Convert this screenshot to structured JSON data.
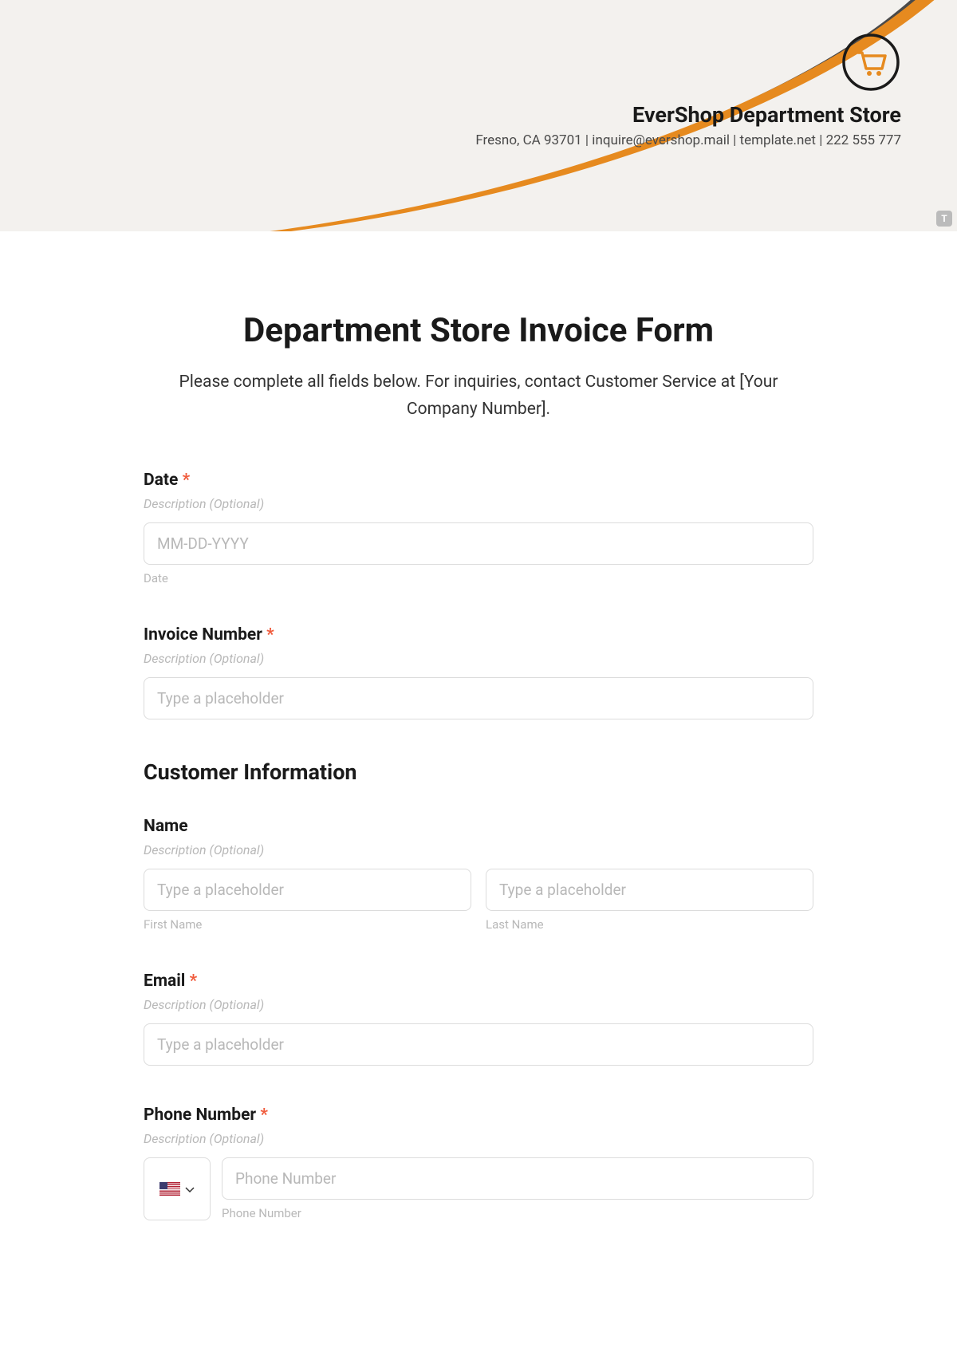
{
  "header": {
    "company_name": "EverShop Department Store",
    "contact_line": "Fresno, CA 93701 | inquire@evershop.mail | template.net | 222 555 777",
    "badge": "T"
  },
  "form": {
    "title": "Department Store Invoice Form",
    "subtitle": "Please complete all fields below. For inquiries, contact Customer Service at [Your Company Number].",
    "fields": {
      "date": {
        "label": "Date",
        "required": "*",
        "description": "Description (Optional)",
        "placeholder": "MM-DD-YYYY",
        "sublabel": "Date"
      },
      "invoice_number": {
        "label": "Invoice Number",
        "required": "*",
        "description": "Description (Optional)",
        "placeholder": "Type a placeholder"
      },
      "customer_section": "Customer Information",
      "name": {
        "label": "Name",
        "description": "Description (Optional)",
        "first_placeholder": "Type a placeholder",
        "first_sublabel": "First Name",
        "last_placeholder": "Type a placeholder",
        "last_sublabel": "Last Name"
      },
      "email": {
        "label": "Email",
        "required": "*",
        "description": "Description (Optional)",
        "placeholder": "Type a placeholder"
      },
      "phone": {
        "label": "Phone Number",
        "required": "*",
        "description": "Description (Optional)",
        "placeholder": "Phone Number",
        "sublabel": "Phone Number"
      }
    }
  }
}
